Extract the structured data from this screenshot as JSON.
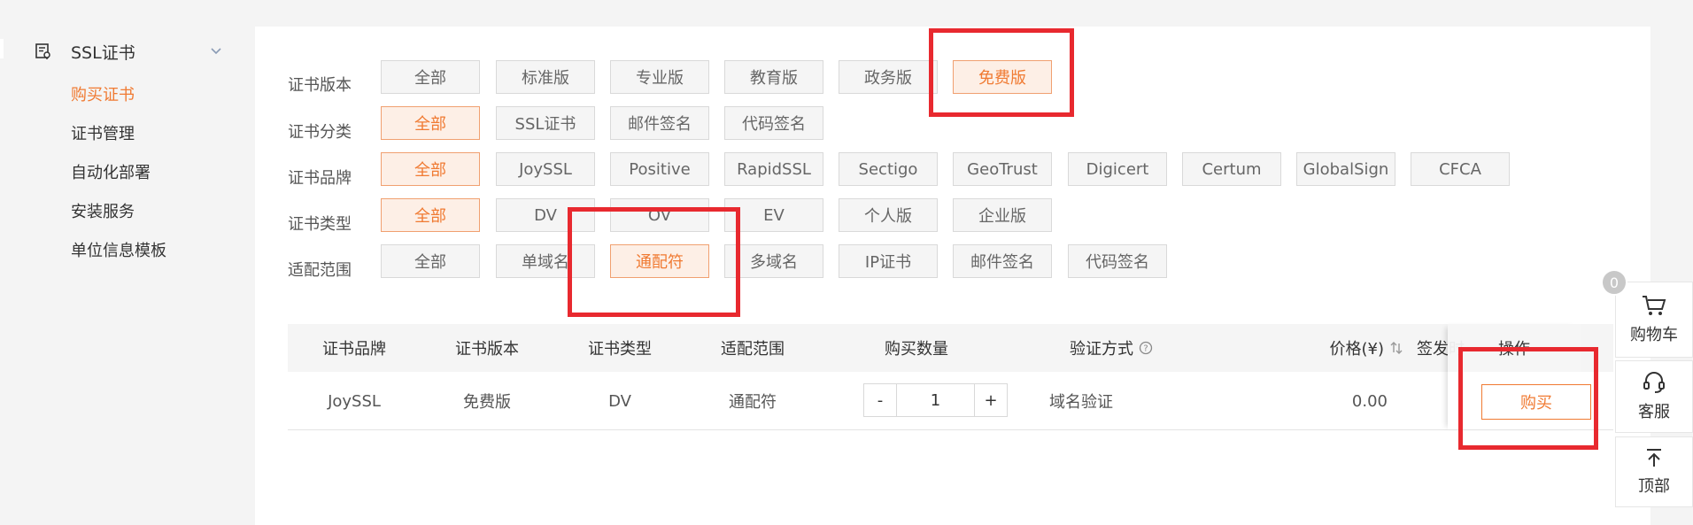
{
  "sidebar": {
    "section_title": "SSL证书",
    "items": [
      {
        "label": "购买证书",
        "active": true
      },
      {
        "label": "证书管理"
      },
      {
        "label": "自动化部署"
      },
      {
        "label": "安装服务"
      },
      {
        "label": "单位信息模板"
      }
    ]
  },
  "filters": {
    "version": {
      "label": "证书版本",
      "options": [
        "全部",
        "标准版",
        "专业版",
        "教育版",
        "政务版",
        "免费版"
      ],
      "selected": "免费版"
    },
    "category": {
      "label": "证书分类",
      "options": [
        "全部",
        "SSL证书",
        "邮件签名",
        "代码签名"
      ],
      "selected": "全部"
    },
    "brand": {
      "label": "证书品牌",
      "options": [
        "全部",
        "JoySSL",
        "Positive",
        "RapidSSL",
        "Sectigo",
        "GeoTrust",
        "Digicert",
        "Certum",
        "GlobalSign",
        "CFCA"
      ],
      "selected": "全部"
    },
    "type": {
      "label": "证书类型",
      "options": [
        "全部",
        "DV",
        "OV",
        "EV",
        "个人版",
        "企业版"
      ],
      "selected": "全部"
    },
    "scope": {
      "label": "适配范围",
      "options": [
        "全部",
        "单域名",
        "通配符",
        "多域名",
        "IP证书",
        "邮件签名",
        "代码签名"
      ],
      "selected": "通配符"
    }
  },
  "table": {
    "headers": {
      "brand": "证书品牌",
      "version": "证书版本",
      "type": "证书类型",
      "scope": "适配范围",
      "quantity": "购买数量",
      "verify": "验证方式",
      "price": "价格(¥)",
      "issue_time": "签发时",
      "action": "操作"
    },
    "row": {
      "brand": "JoySSL",
      "version": "免费版",
      "type": "DV",
      "scope": "通配符",
      "quantity": "1",
      "verify": "域名验证",
      "price": "0.00",
      "minus": "-",
      "plus": "+",
      "buy_label": "购买"
    }
  },
  "floating": {
    "cart_count": "0",
    "cart_label": "购物车",
    "service_label": "客服",
    "top_label": "顶部"
  },
  "colors": {
    "accent": "#f07a32",
    "annotation_red": "#e8292f",
    "selected_bg": "#fdefe6"
  }
}
